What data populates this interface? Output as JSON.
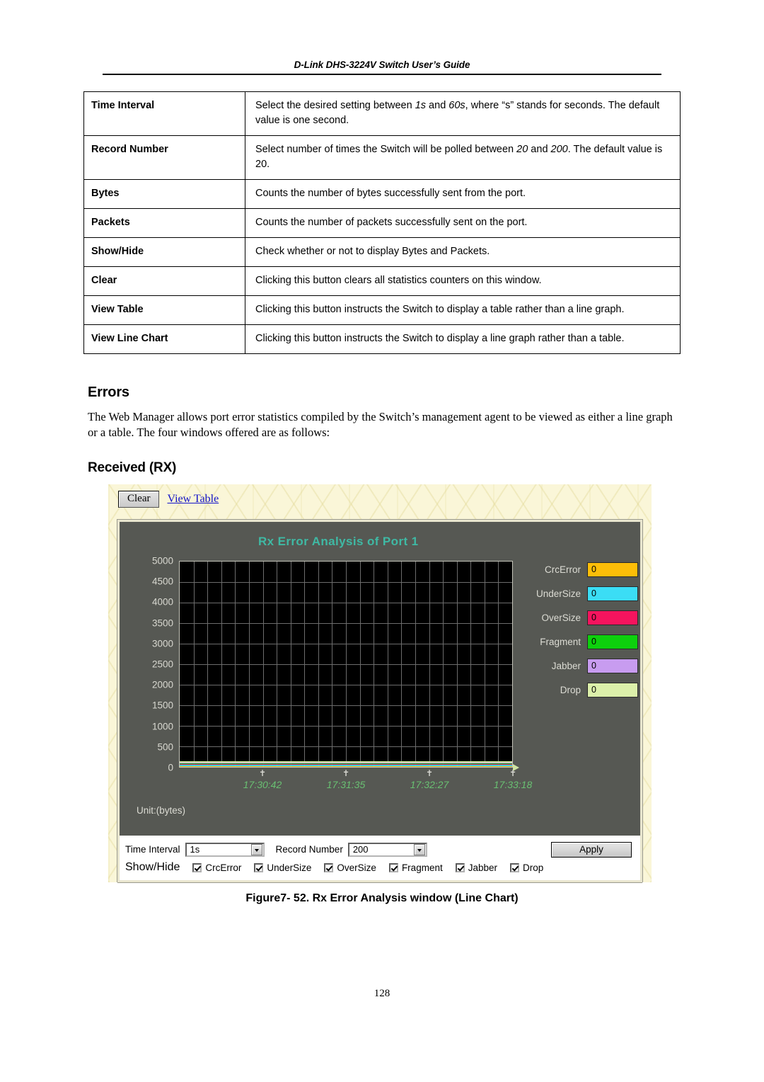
{
  "header": {
    "title": "D-Link DHS-3224V Switch User’s Guide"
  },
  "definition_table": {
    "rows": [
      {
        "term": "Time Interval",
        "desc_pre": "Select the desired setting between ",
        "desc_i1": "1s",
        "desc_mid": " and ",
        "desc_i2": "60s",
        "desc_post": ", where “s” stands for seconds. The default value is one second."
      },
      {
        "term": "Record Number",
        "desc_pre": "Select number of times the Switch will be polled between ",
        "desc_i1": "20",
        "desc_mid": " and ",
        "desc_i2": "200",
        "desc_post": ". The default value is 20."
      },
      {
        "term": "Bytes",
        "desc": "Counts the number of bytes successfully sent from the port."
      },
      {
        "term": "Packets",
        "desc": "Counts the number of packets successfully sent on the port."
      },
      {
        "term": "Show/Hide",
        "desc": "Check whether or not to display Bytes and Packets."
      },
      {
        "term": "Clear",
        "desc": "Clicking this button clears all statistics counters on this window."
      },
      {
        "term": "View Table",
        "desc": "Clicking this button instructs the Switch to display a table rather than a line graph."
      },
      {
        "term": "View Line Chart",
        "desc": "Clicking this button instructs the Switch to display a line graph rather than a table."
      }
    ]
  },
  "errors_section": {
    "heading": "Errors",
    "paragraph": "The Web Manager allows port error statistics compiled by the Switch’s management agent to be viewed as either a line graph or a table. The four windows offered are as follows:",
    "subheading": "Received (RX)"
  },
  "screenshot": {
    "toolbar": {
      "clear_button": "Clear",
      "view_table_link": "View Table"
    },
    "unit_label": "Unit:(bytes)",
    "form": {
      "time_interval_label": "Time Interval",
      "time_interval_value": "1s",
      "record_number_label": "Record Number",
      "record_number_value": "200",
      "apply_button": "Apply",
      "show_hide_label": "Show/Hide",
      "checkboxes": [
        {
          "label": "CrcError",
          "checked": true
        },
        {
          "label": "UnderSize",
          "checked": true
        },
        {
          "label": "OverSize",
          "checked": true
        },
        {
          "label": "Fragment",
          "checked": true
        },
        {
          "label": "Jabber",
          "checked": true
        },
        {
          "label": "Drop",
          "checked": true
        }
      ]
    }
  },
  "chart_data": {
    "type": "line",
    "title": "Rx Error Analysis of Port 1",
    "xlabel": "",
    "ylabel": "",
    "unit": "Unit:(bytes)",
    "ylim": [
      0,
      5000
    ],
    "yticks": [
      5000,
      4500,
      4000,
      3500,
      3000,
      2500,
      2000,
      1500,
      1000,
      500,
      0
    ],
    "xticks": [
      "17:30:42",
      "17:31:35",
      "17:32:27",
      "17:33:18"
    ],
    "xtick_positions": [
      0.25,
      0.5,
      0.75,
      1.0
    ],
    "grid": true,
    "grid_columns": 24,
    "grid_rows": 10,
    "legend_position": "right",
    "title_color": "#3fb9a4",
    "plot_background": "#000000",
    "panel_background": "#565853",
    "series": [
      {
        "name": "CrcError",
        "value": "0",
        "color": "#FDBE08",
        "values": [
          0,
          0,
          0,
          0
        ]
      },
      {
        "name": "UnderSize",
        "value": "0",
        "color": "#3BDDF5",
        "values": [
          0,
          0,
          0,
          0
        ]
      },
      {
        "name": "OverSize",
        "value": "0",
        "color": "#F5145E",
        "values": [
          0,
          0,
          0,
          0
        ]
      },
      {
        "name": "Fragment",
        "value": "0",
        "color": "#0DD00D",
        "values": [
          0,
          0,
          0,
          0
        ]
      },
      {
        "name": "Jabber",
        "value": "0",
        "color": "#C89CF0",
        "values": [
          0,
          0,
          0,
          0
        ]
      },
      {
        "name": "Drop",
        "value": "0",
        "color": "#DCF0AA",
        "values": [
          0,
          0,
          0,
          0
        ]
      }
    ]
  },
  "caption": "Figure7- 52.  Rx Error Analysis window (Line Chart)",
  "page_number": "128"
}
